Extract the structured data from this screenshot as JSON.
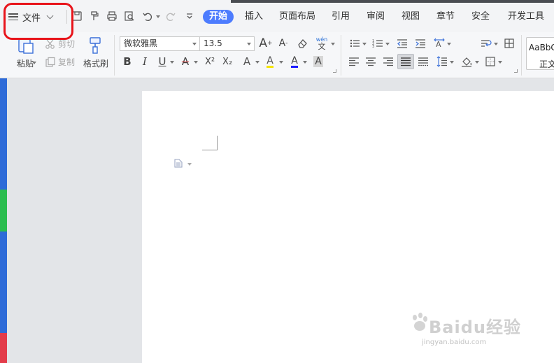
{
  "menubar": {
    "file_label": "文件",
    "tabs": [
      {
        "label": "开始",
        "active": true
      },
      {
        "label": "插入"
      },
      {
        "label": "页面布局"
      },
      {
        "label": "引用"
      },
      {
        "label": "审阅"
      },
      {
        "label": "视图"
      },
      {
        "label": "章节"
      },
      {
        "label": "安全"
      },
      {
        "label": "开发工具"
      }
    ],
    "quick_access": [
      "save-icon",
      "format-painter-quick-icon",
      "print-icon",
      "print-preview-icon",
      "undo-icon",
      "redo-icon",
      "customize-icon"
    ]
  },
  "ribbon": {
    "paste_label": "粘贴",
    "cut_label": "剪切",
    "copy_label": "复制",
    "format_painter_label": "格式刷",
    "font_name": "微软雅黑",
    "font_size": "13.5",
    "bold": "B",
    "italic": "I",
    "underline": "U",
    "strike": "A",
    "superscript": "X²",
    "subscript": "X₂",
    "text_effect": "A",
    "highlight": "A",
    "font_color": "A",
    "char_shading": "A",
    "grow_font": "A",
    "shrink_font": "A",
    "phonetic": "wén",
    "style_preview": "AaBbC",
    "style_name": "正文"
  },
  "watermark": {
    "brand": "Baidu经验",
    "url": "jingyan.baidu.com"
  },
  "colors": {
    "accent": "#4d7cfe",
    "highlight_box": "#e8141b",
    "font_color_bar": "#1a1aff"
  }
}
